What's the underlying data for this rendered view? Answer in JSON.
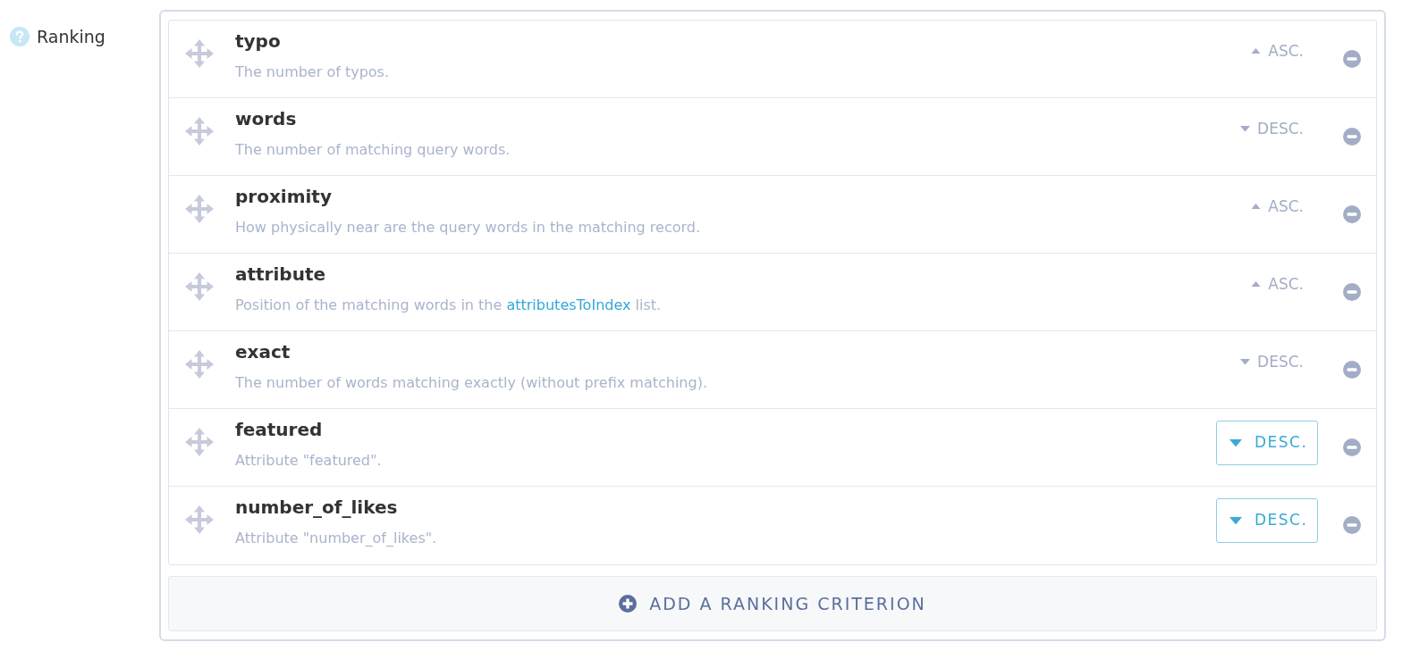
{
  "field": {
    "label": "Ranking"
  },
  "criteria": [
    {
      "name": "typo",
      "description": [
        {
          "kind": "text",
          "text": "The number of typos."
        }
      ],
      "order": {
        "kind": "plain",
        "label": "ASC.",
        "ascending": true
      }
    },
    {
      "name": "words",
      "description": [
        {
          "kind": "text",
          "text": "The number of matching query words."
        }
      ],
      "order": {
        "kind": "plain",
        "label": "DESC.",
        "ascending": false
      }
    },
    {
      "name": "proximity",
      "description": [
        {
          "kind": "text",
          "text": "How physically near are the query words in the matching record."
        }
      ],
      "order": {
        "kind": "plain",
        "label": "ASC.",
        "ascending": true
      }
    },
    {
      "name": "attribute",
      "description": [
        {
          "kind": "text",
          "text": "Position of the matching words in the "
        },
        {
          "kind": "link",
          "text": "attributesToIndex"
        },
        {
          "kind": "text",
          "text": " list."
        }
      ],
      "order": {
        "kind": "plain",
        "label": "ASC.",
        "ascending": true
      }
    },
    {
      "name": "exact",
      "description": [
        {
          "kind": "text",
          "text": "The number of words matching exactly (without prefix matching)."
        }
      ],
      "order": {
        "kind": "plain",
        "label": "DESC.",
        "ascending": false
      }
    },
    {
      "name": "featured",
      "description": [
        {
          "kind": "text",
          "text": "Attribute \"featured\"."
        }
      ],
      "order": {
        "kind": "button",
        "label": "DESC.",
        "ascending": false
      }
    },
    {
      "name": "number_of_likes",
      "description": [
        {
          "kind": "text",
          "text": "Attribute \"number_of_likes\"."
        }
      ],
      "order": {
        "kind": "button",
        "label": "DESC.",
        "ascending": false
      }
    }
  ],
  "add_button": {
    "label": "ADD A RANKING CRITERION"
  }
}
